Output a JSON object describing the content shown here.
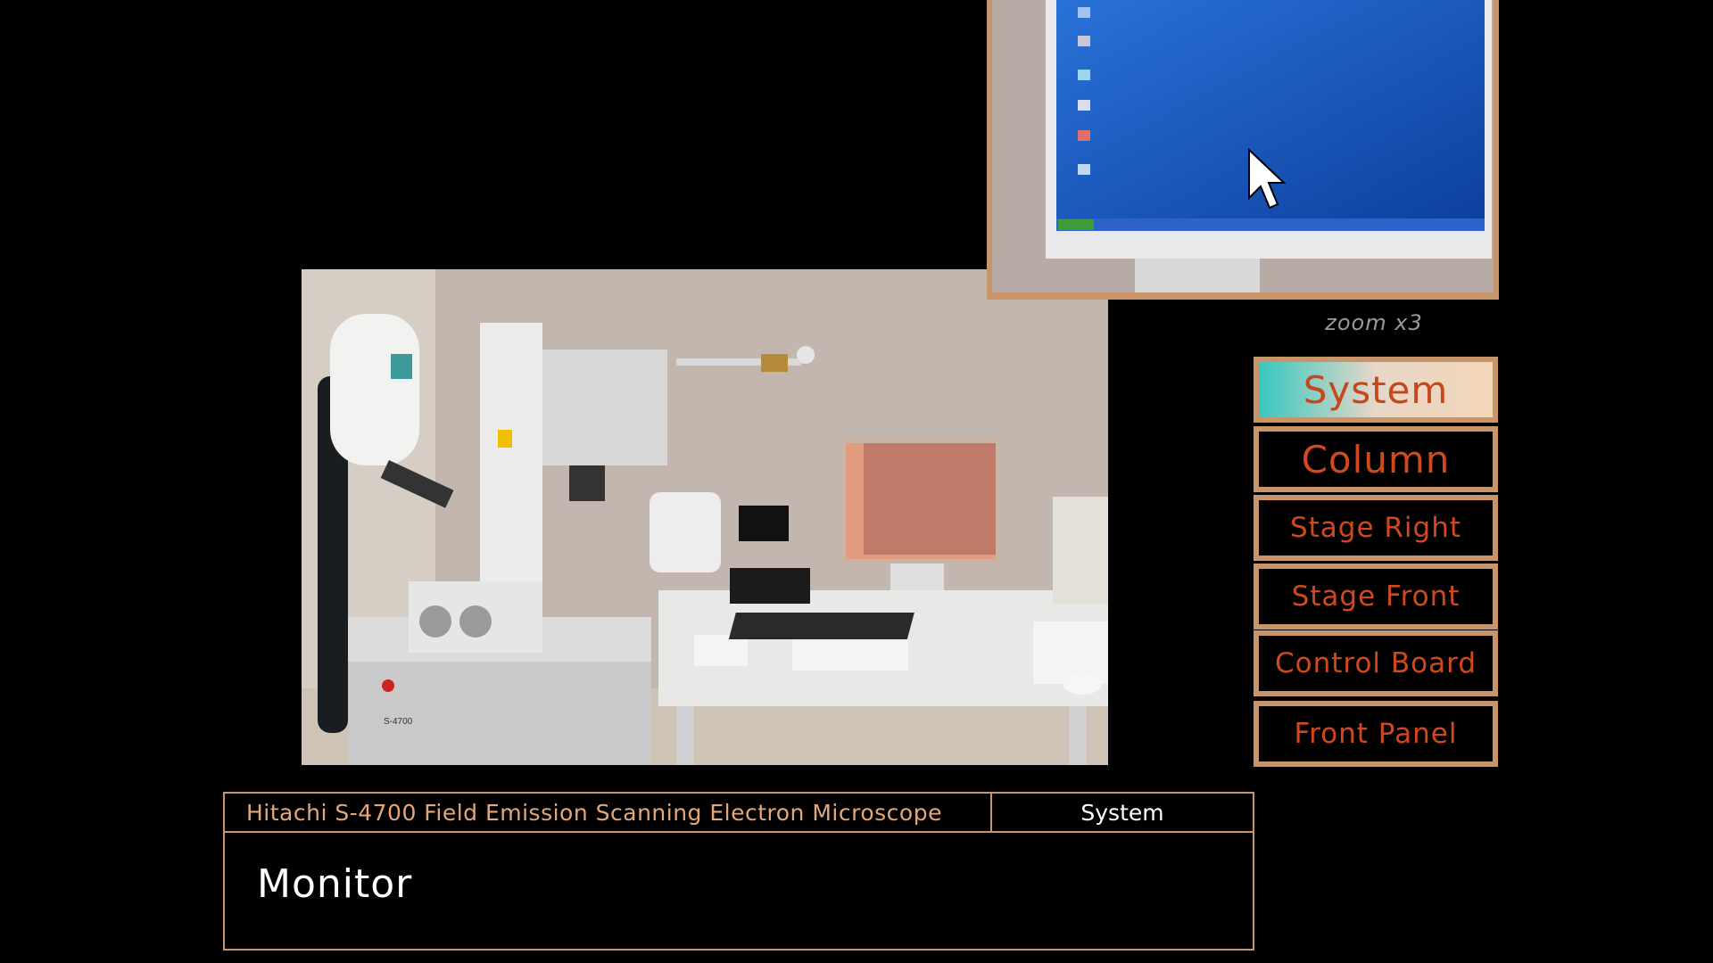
{
  "zoom": {
    "label": "zoom x3"
  },
  "nav": {
    "items": [
      {
        "label": "System",
        "active": true
      },
      {
        "label": "Column",
        "active": false
      },
      {
        "label": "Stage Right",
        "active": false
      },
      {
        "label": "Stage Front",
        "active": false
      },
      {
        "label": "Control Board",
        "active": false
      },
      {
        "label": "Front Panel",
        "active": false
      }
    ]
  },
  "info": {
    "title": "Hitachi S-4700 Field Emission Scanning Electron Microscope",
    "section": "System",
    "detail": "Monitor"
  },
  "photo": {
    "model_plate": "S-4700"
  },
  "colors": {
    "frame": "#c8956a",
    "nav_text": "#d0481e",
    "title_text": "#e2a77a",
    "highlight": "#f0a070"
  }
}
